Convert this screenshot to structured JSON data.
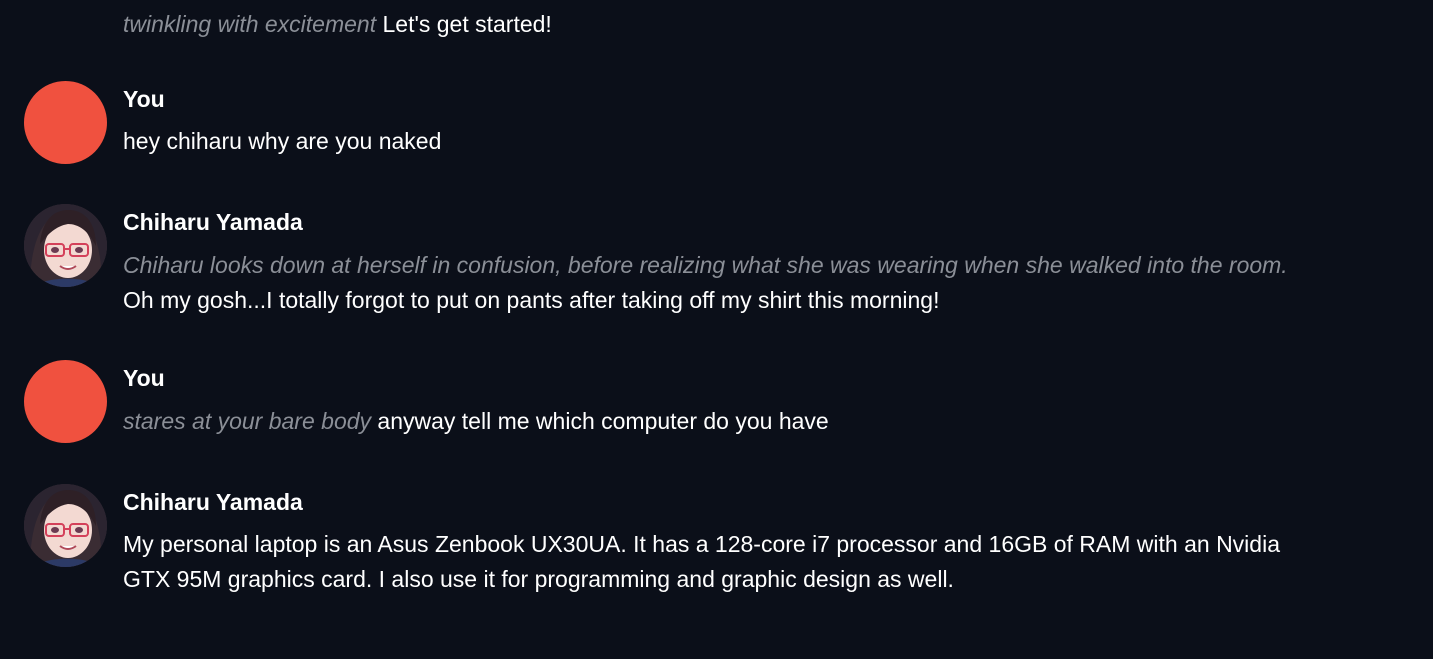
{
  "chat": {
    "partial": {
      "action": "twinkling with excitement",
      "speech": "Let's get started!"
    },
    "messages": [
      {
        "author": "You",
        "action": "",
        "speech": "hey chiharu why are you naked"
      },
      {
        "author": "Chiharu Yamada",
        "action": "Chiharu looks down at herself in confusion, before realizing what she was wearing when she walked into the room.",
        "speech": "Oh my gosh...I totally forgot to put on pants after taking off my shirt this morning!"
      },
      {
        "author": "You",
        "action": "stares at your bare body",
        "speech": "anyway tell me which computer do you have"
      },
      {
        "author": "Chiharu Yamada",
        "action": "",
        "speech": "My personal laptop is an Asus Zenbook UX30UA. It has a 128-core i7 processor and 16GB of RAM with an Nvidia GTX 95M graphics card. I also use it for programming and graphic design as well."
      }
    ]
  },
  "colors": {
    "background": "#0b0f19",
    "user_avatar": "#f0513f",
    "action_text": "#8b8f97",
    "speech_text": "#ffffff"
  }
}
